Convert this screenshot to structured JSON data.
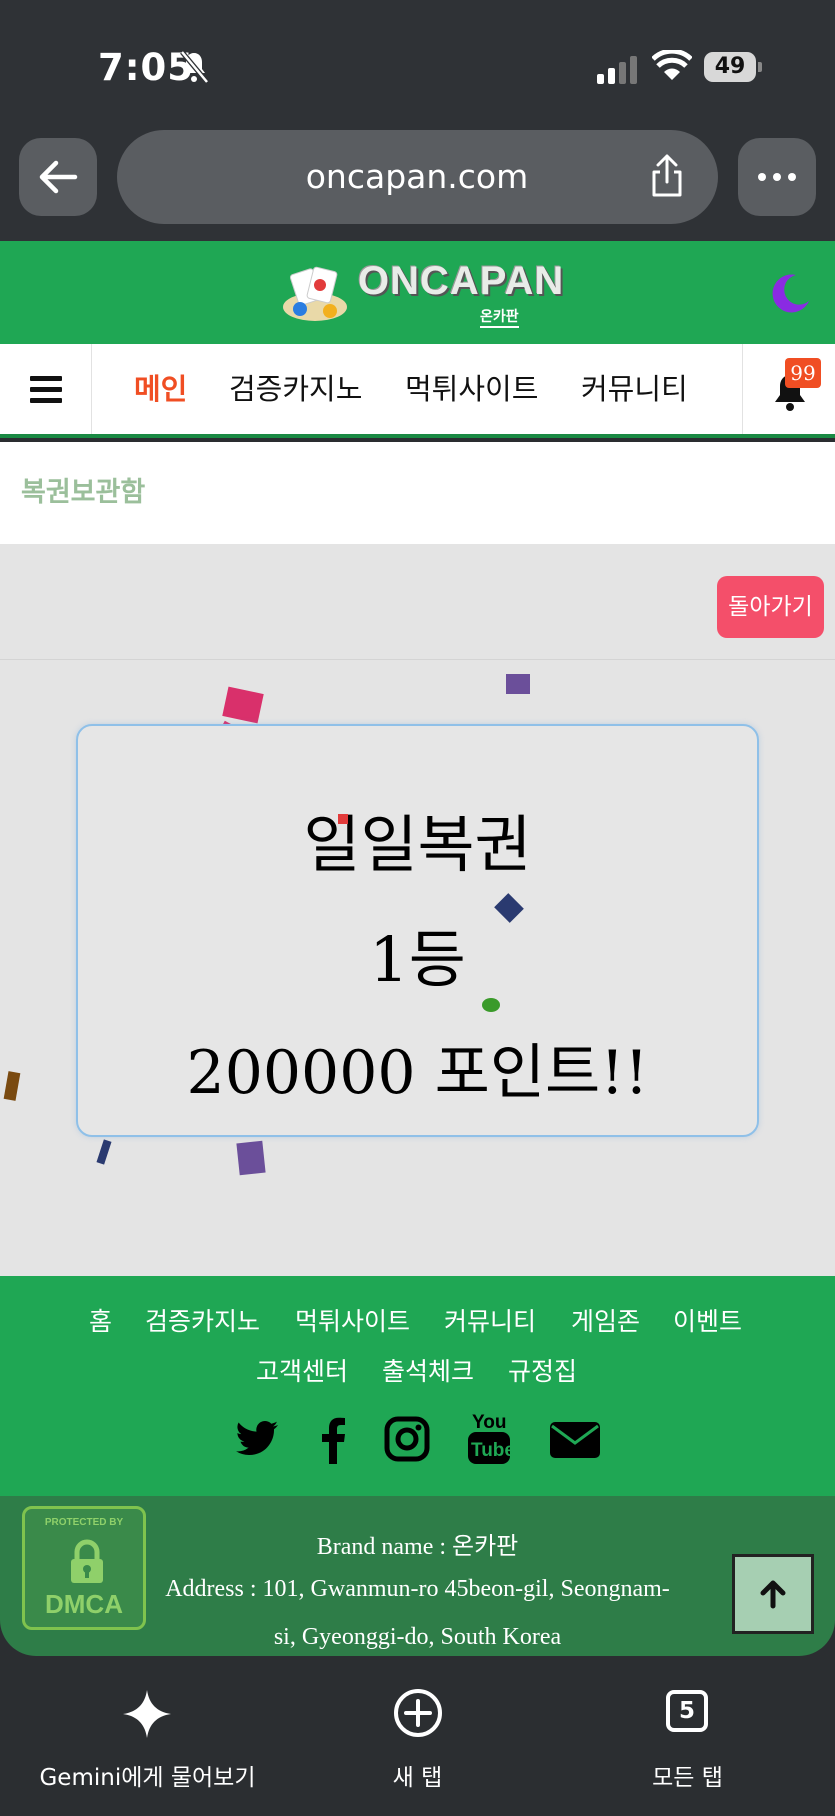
{
  "status_bar": {
    "time": "7:05",
    "battery": "49"
  },
  "browser": {
    "url": "oncapan.com"
  },
  "site": {
    "logo_text": "ONCAPAN",
    "logo_sub": "온카판"
  },
  "nav": {
    "items": [
      {
        "label": "메인",
        "active": true
      },
      {
        "label": "검증카지노"
      },
      {
        "label": "먹튀사이트"
      },
      {
        "label": "커뮤니티"
      }
    ],
    "badge": "99"
  },
  "breadcrumb": "복권보관함",
  "back_button": "돌아가기",
  "prize": {
    "line1": "일일복권",
    "line2": "1등",
    "line3": "200000 포인트!!"
  },
  "footer": {
    "links_row1": [
      "홈",
      "검증카지노",
      "먹튀사이트",
      "커뮤니티",
      "게임존",
      "이벤트"
    ],
    "links_row2": [
      "고객센터",
      "출석체크",
      "규정집"
    ],
    "social_icons": [
      "twitter-icon",
      "facebook-icon",
      "instagram-icon",
      "youtube-icon",
      "mail-icon"
    ],
    "dmca_top": "PROTECTED BY",
    "dmca": "DMCA",
    "brand": "Brand name : 온카판",
    "address_line1": "Address : 101, Gwanmun-ro 45beon-gil, Seongnam-",
    "address_line2": "si, Gyeonggi-do, South Korea"
  },
  "toolbar": {
    "gemini": "Gemini에게 물어보기",
    "new_tab": "새 탭",
    "all_tabs": "모든 탭",
    "tab_count": "5"
  },
  "colors": {
    "brand_green": "#1fa754",
    "active_nav": "#f04e23",
    "back_button": "#f44f6a"
  }
}
